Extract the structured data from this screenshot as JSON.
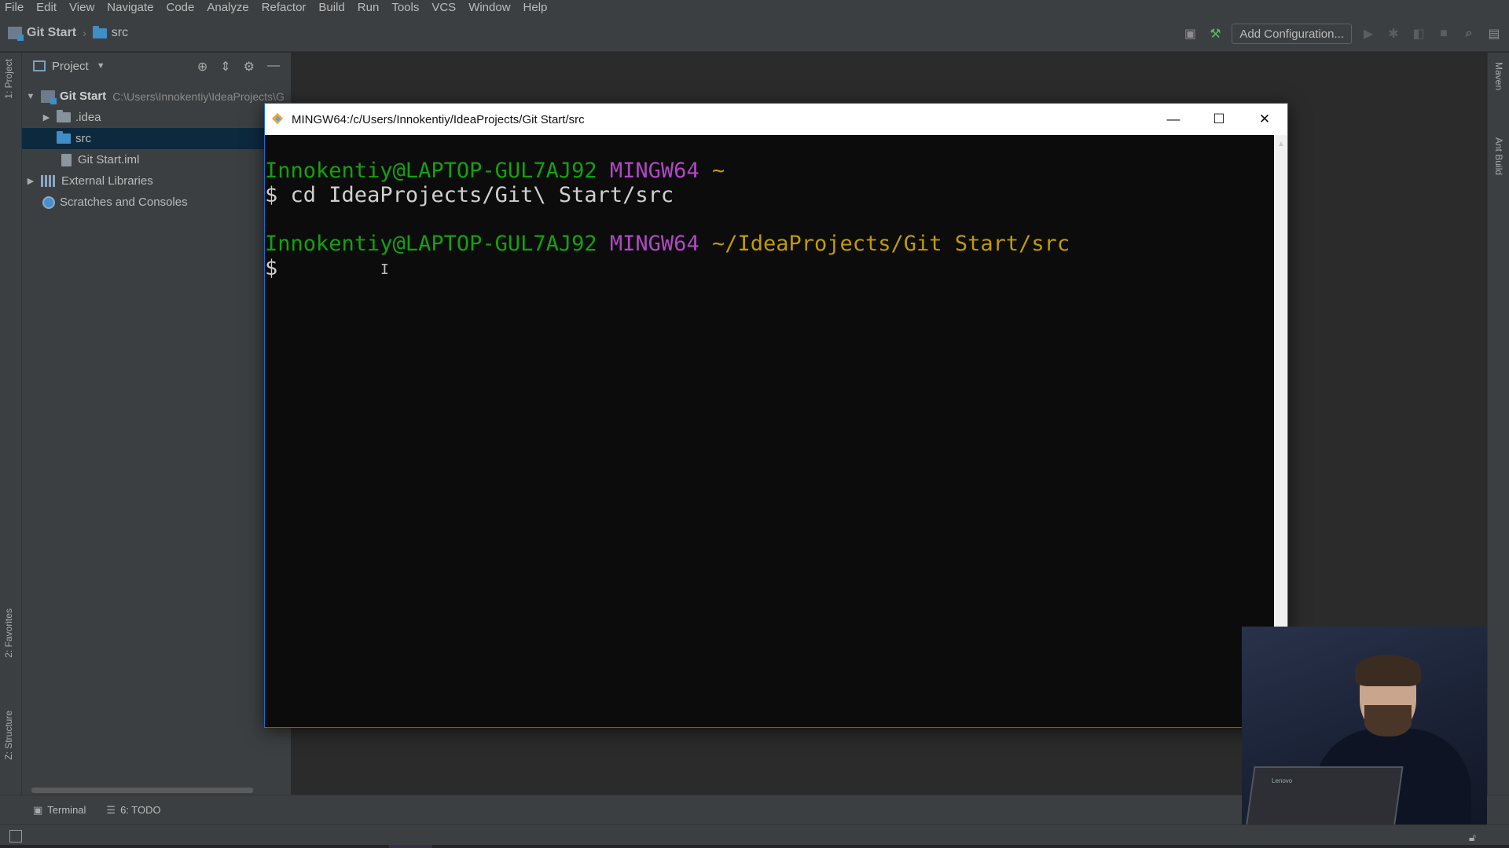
{
  "menu": [
    "File",
    "Edit",
    "View",
    "Navigate",
    "Code",
    "Analyze",
    "Refactor",
    "Build",
    "Run",
    "Tools",
    "VCS",
    "Window",
    "Help"
  ],
  "breadcrumb": {
    "project": "Git Start",
    "folder": "src"
  },
  "toolbar": {
    "add_config": "Add Configuration..."
  },
  "left_tabs": {
    "project": "1: Project",
    "favorites": "2: Favorites",
    "structure": "Z: Structure"
  },
  "right_tabs": {
    "maven": "Maven",
    "ant": "Ant Build"
  },
  "project_panel": {
    "title": "Project",
    "tree": [
      {
        "label": "Git Start",
        "path": "C:\\Users\\Innokentiy\\IdeaProjects\\G"
      },
      {
        "label": ".idea"
      },
      {
        "label": "src"
      },
      {
        "label": "Git Start.iml"
      },
      {
        "label": "External Libraries"
      },
      {
        "label": "Scratches and Consoles"
      }
    ]
  },
  "bottom_tabs": {
    "terminal": "Terminal",
    "todo": "6: TODO"
  },
  "terminal": {
    "title": "MINGW64:/c/Users/Innokentiy/IdeaProjects/Git Start/src",
    "lines": [
      {
        "user": "Innokentiy@LAPTOP-GUL7AJ92",
        "env": "MINGW64",
        "dir": "~"
      },
      {
        "prompt": "$",
        "command": "cd IdeaProjects/Git\\ Start/src"
      },
      {
        "user": "Innokentiy@LAPTOP-GUL7AJ92",
        "env": "MINGW64",
        "dir": "~/IdeaProjects/Git Start/src"
      },
      {
        "prompt": "$",
        "command": ""
      }
    ]
  },
  "webcam": {
    "laptop_brand": "Lenovo"
  },
  "colors": {
    "ide_bg": "#2b2b2b",
    "panel_bg": "#3c3f41",
    "selection": "#0d293e",
    "term_green": "#13a10e",
    "term_magenta": "#b148c6",
    "term_yellow": "#c19c00",
    "window_border": "#1a6ec4"
  }
}
